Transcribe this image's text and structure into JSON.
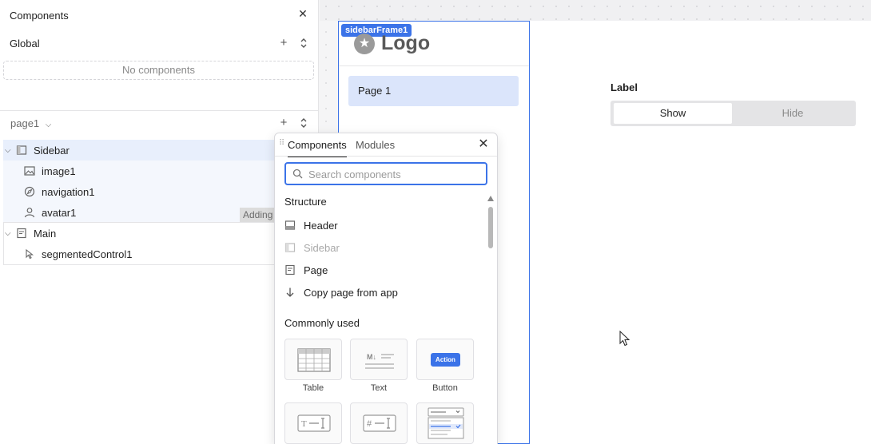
{
  "panel": {
    "title": "Components",
    "global_title": "Global",
    "global_empty": "No components",
    "page_select": "page1",
    "tree": [
      {
        "label": "Sidebar",
        "icon": "sidebar-icon",
        "level": 0
      },
      {
        "label": "image1",
        "icon": "image-icon",
        "level": 1
      },
      {
        "label": "navigation1",
        "icon": "compass-icon",
        "level": 1
      },
      {
        "label": "avatar1",
        "icon": "user-icon",
        "level": 1
      },
      {
        "label": "Main",
        "icon": "page-icon",
        "level": 0
      },
      {
        "label": "segmentedControl1",
        "icon": "pointer-icon",
        "level": 1
      }
    ],
    "adding_badge": "Adding"
  },
  "canvas": {
    "frame_tag": "sidebarFrame1",
    "logo_text": "Logo",
    "nav_item": "Page 1",
    "segmented": {
      "label": "Label",
      "options": [
        "Show",
        "Hide"
      ],
      "selected": "Show"
    }
  },
  "popover": {
    "tabs": [
      "Components",
      "Modules"
    ],
    "active_tab": "Components",
    "search_placeholder": "Search components",
    "search_value": "",
    "structure_title": "Structure",
    "structure_items": [
      {
        "label": "Header",
        "icon": "header-icon",
        "disabled": false
      },
      {
        "label": "Sidebar",
        "icon": "sidebar-icon",
        "disabled": true
      },
      {
        "label": "Page",
        "icon": "page-icon",
        "disabled": false
      },
      {
        "label": "Copy page from app",
        "icon": "arrow-down-icon",
        "disabled": false
      }
    ],
    "common_title": "Commonly used",
    "tiles": [
      {
        "label": "Table",
        "icon": "table-icon"
      },
      {
        "label": "Text",
        "icon": "markdown-text-icon"
      },
      {
        "label": "Button",
        "icon": "button-icon",
        "pill": "Action"
      },
      {
        "label": "",
        "icon": "text-input-icon"
      },
      {
        "label": "",
        "icon": "number-input-icon"
      },
      {
        "label": "",
        "icon": "select-icon"
      }
    ]
  },
  "colors": {
    "accent": "#3b73e8",
    "selected_bg": "#e8effc",
    "nav_active_bg": "#dbe5fb"
  }
}
